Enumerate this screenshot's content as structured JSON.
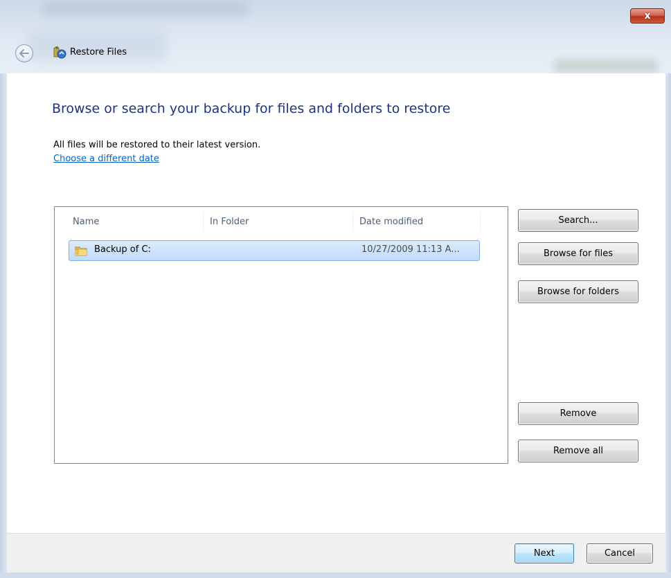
{
  "window": {
    "title": "Restore Files",
    "close_label": "x"
  },
  "main": {
    "heading": "Browse or search your backup for files and folders to restore",
    "info": "All files will be restored to their latest version.",
    "date_link": "Choose a different date"
  },
  "list": {
    "columns": [
      "Name",
      "In Folder",
      "Date modified"
    ],
    "rows": [
      {
        "name": "Backup of C:",
        "folder": "",
        "date": "10/27/2009 11:13 A..."
      }
    ]
  },
  "side_buttons": {
    "search": "Search...",
    "browse_files": "Browse for files",
    "browse_folders": "Browse for folders",
    "remove": "Remove",
    "remove_all": "Remove all"
  },
  "footer": {
    "next": "Next",
    "cancel": "Cancel"
  },
  "icons": {
    "back": "back-arrow-icon",
    "restore": "restore-files-icon",
    "folder": "folder-icon",
    "close": "close-icon"
  },
  "colors": {
    "heading": "#1e3287",
    "link": "#0066cc",
    "selection": "#c1dbfc",
    "close_button": "#c7432b"
  }
}
